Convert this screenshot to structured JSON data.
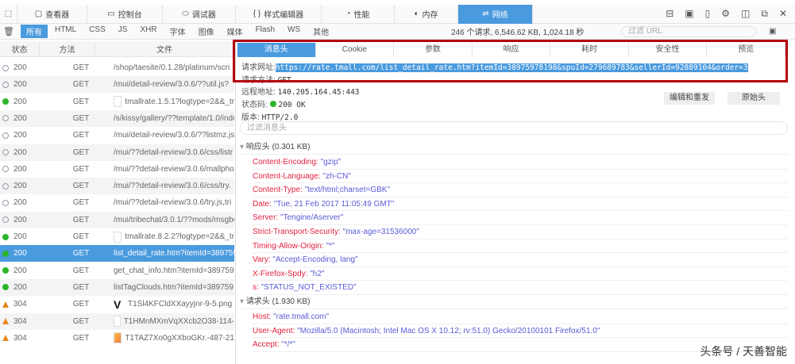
{
  "toolbar": {
    "tabs": [
      {
        "label": "查看器",
        "icon": "inspector-icon"
      },
      {
        "label": "控制台",
        "icon": "console-icon"
      },
      {
        "label": "调试器",
        "icon": "debugger-icon"
      },
      {
        "label": "样式编辑器",
        "icon": "style-editor-icon"
      },
      {
        "label": "性能",
        "icon": "performance-icon"
      },
      {
        "label": "内存",
        "icon": "memory-icon"
      },
      {
        "label": "网络",
        "icon": "network-icon",
        "active": true
      }
    ]
  },
  "filters": {
    "types": [
      "所有",
      "HTML",
      "CSS",
      "JS",
      "XHR",
      "字体",
      "图像",
      "媒体",
      "Flash",
      "WS",
      "其他"
    ],
    "summary": "246 个请求, 6,546.62 KB, 1,024.18 秒",
    "url_placeholder": "过滤 URL"
  },
  "columns": {
    "status": "状态",
    "method": "方法",
    "file": "文件"
  },
  "requests": [
    {
      "status": "200",
      "method": "GET",
      "file": "/shop/taesite/0.1.28/platinum/scri",
      "dot": "empty"
    },
    {
      "status": "200",
      "method": "GET",
      "file": "/mui/detail-review/3.0.6/??util.js?",
      "dot": "empty"
    },
    {
      "status": "200",
      "method": "GET",
      "file": "tmallrate.1.5.1?logtype=2&&_tr",
      "dot": "green",
      "thumb": true
    },
    {
      "status": "200",
      "method": "GET",
      "file": "/s/kissy/gallery/??template/1.0/inde",
      "dot": "empty"
    },
    {
      "status": "200",
      "method": "GET",
      "file": "/mui/detail-review/3.0.6/??listmz.js",
      "dot": "empty"
    },
    {
      "status": "200",
      "method": "GET",
      "file": "/mui/??detail-review/3.0.6/css/listr",
      "dot": "empty"
    },
    {
      "status": "200",
      "method": "GET",
      "file": "/mui/??detail-review/3.0.6/mallpho",
      "dot": "empty"
    },
    {
      "status": "200",
      "method": "GET",
      "file": "/mui/??detail-review/3.0.6/css/try.",
      "dot": "empty"
    },
    {
      "status": "200",
      "method": "GET",
      "file": "/mui/??detail-review/3.0.6/try.js,tri",
      "dot": "empty"
    },
    {
      "status": "200",
      "method": "GET",
      "file": "/mui/tribechat/3.0.1/??mods/msgbo",
      "dot": "empty"
    },
    {
      "status": "200",
      "method": "GET",
      "file": "tmallrate.8.2.2?logtype=2&&_tr",
      "dot": "green",
      "thumb": true
    },
    {
      "status": "200",
      "method": "GET",
      "file": "list_detail_rate.htm?itemId=389759",
      "dot": "green",
      "selected": true
    },
    {
      "status": "200",
      "method": "GET",
      "file": "get_chat_info.htm?itemId=389759",
      "dot": "green"
    },
    {
      "status": "200",
      "method": "GET",
      "file": "listTagClouds.htm?itemId=389759",
      "dot": "green"
    },
    {
      "status": "304",
      "method": "GET",
      "file": "T1Sl4KFCldXXayyjnr-9-5.png",
      "dot": "warn",
      "thumb": "v"
    },
    {
      "status": "304",
      "method": "GET",
      "file": "T1HMnMXmVqXXcb2O38-114-",
      "dot": "warn",
      "thumb": true
    },
    {
      "status": "304",
      "method": "GET",
      "file": "T1TAZ7Xo0gXXboGKr.-487-21",
      "dot": "warn",
      "thumb": "orange"
    }
  ],
  "detail": {
    "tabs": [
      "消息头",
      "Cookie",
      "参数",
      "响应",
      "耗时",
      "安全性",
      "预览"
    ],
    "request_url_label": "请求网址:",
    "request_url": "https://rate.tmall.com/list_detail_rate.htm?itemId=38975978198&spuId=279689783&sellerId=92889104&order=3",
    "method_label": "请求方法:",
    "method": "GET",
    "remote_label": "远程地址:",
    "remote": "140.205.164.45:443",
    "status_label": "状态码:",
    "status": "200 OK",
    "version_label": "版本:",
    "version": "HTTP/2.0",
    "edit_resend": "编辑和重发",
    "raw_headers": "原始头",
    "filter_placeholder": "过滤消息头",
    "response_section": "响应头 (0.301 KB)",
    "response_headers": [
      {
        "k": "Content-Encoding:",
        "v": "\"gzip\""
      },
      {
        "k": "Content-Language:",
        "v": "\"zh-CN\""
      },
      {
        "k": "Content-Type:",
        "v": "\"text/html;charset=GBK\""
      },
      {
        "k": "Date:",
        "v": "\"Tue, 21 Feb 2017 11:05:49 GMT\""
      },
      {
        "k": "Server:",
        "v": "\"Tengine/Aserver\""
      },
      {
        "k": "Strict-Transport-Security:",
        "v": "\"max-age=31536000\""
      },
      {
        "k": "Timing-Allow-Origin:",
        "v": "\"*\""
      },
      {
        "k": "Vary:",
        "v": "\"Accept-Encoding, lang\""
      },
      {
        "k": "X-Firefox-Spdy:",
        "v": "\"h2\""
      },
      {
        "k": "s:",
        "v": "\"STATUS_NOT_EXISTED\""
      }
    ],
    "request_section": "请求头 (1.930 KB)",
    "request_headers": [
      {
        "k": "Host:",
        "v": "\"rate.tmall.com\""
      },
      {
        "k": "User-Agent:",
        "v": "\"Mozilla/5.0 (Macintosh; Intel Mac OS X 10.12; rv:51.0) Gecko/20100101 Firefox/51.0\""
      },
      {
        "k": "Accept:",
        "v": "\"*/*\""
      }
    ]
  },
  "watermark": "头条号 / 天善智能"
}
